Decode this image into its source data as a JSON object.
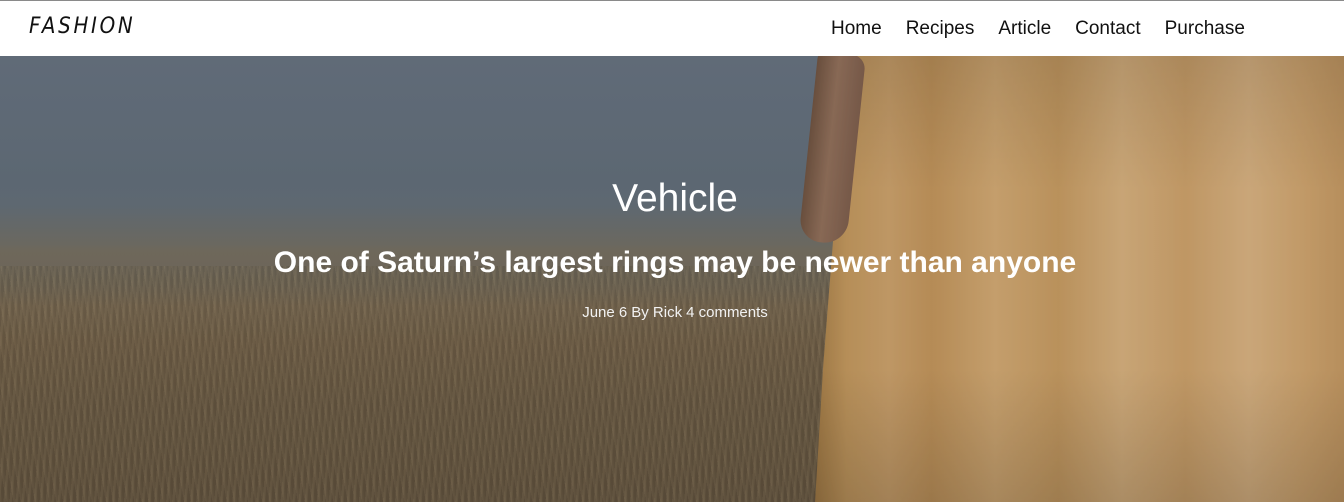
{
  "header": {
    "logo": "FASHION",
    "nav": [
      "Home",
      "Recipes",
      "Article",
      "Contact",
      "Purchase"
    ]
  },
  "hero": {
    "category": "Vehicle",
    "headline": "One of Saturn’s largest rings may be newer than anyone",
    "meta": {
      "date": "June 6",
      "author": "By Rick",
      "comments": "4 comments"
    }
  },
  "colors": {
    "header_bg": "#ffffff",
    "text_dark": "#111111",
    "hero_text": "#ffffff",
    "dress": "#e3b274"
  }
}
